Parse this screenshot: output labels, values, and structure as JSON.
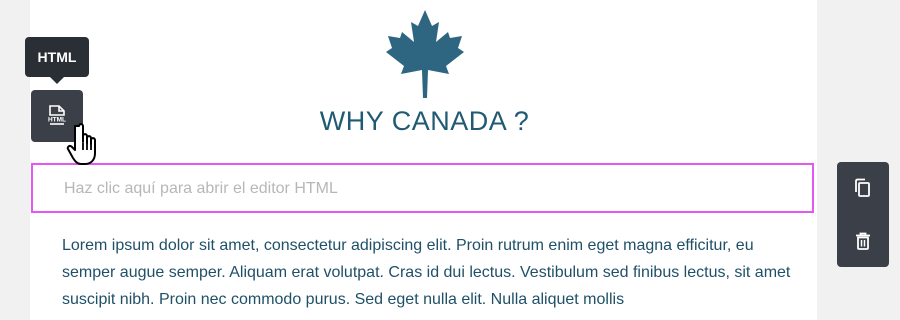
{
  "tooltip": {
    "label": "HTML"
  },
  "tool_button": {
    "icon": "html-file-icon",
    "label": "HTML"
  },
  "heading": {
    "text": "WHY CANADA ?"
  },
  "html_block": {
    "placeholder": "Haz clic aquí para abrir el editor HTML"
  },
  "body_text": "Lorem ipsum dolor sit amet, consectetur adipiscing elit. Proin rutrum enim eget magna efficitur, eu semper augue semper. Aliquam erat volutpat. Cras id dui lectus. Vestibulum sed finibus lectus, sit amet suscipit nibh. Proin nec commodo purus. Sed eget nulla elit. Nulla aliquet mollis",
  "side_toolbar": {
    "buttons": [
      {
        "icon": "copy-icon"
      },
      {
        "icon": "trash-icon"
      }
    ]
  },
  "colors": {
    "heading": "#215a73",
    "block_border": "#e458f2",
    "toolbar": "#3b4048",
    "tooltip": "#2a2f36"
  }
}
